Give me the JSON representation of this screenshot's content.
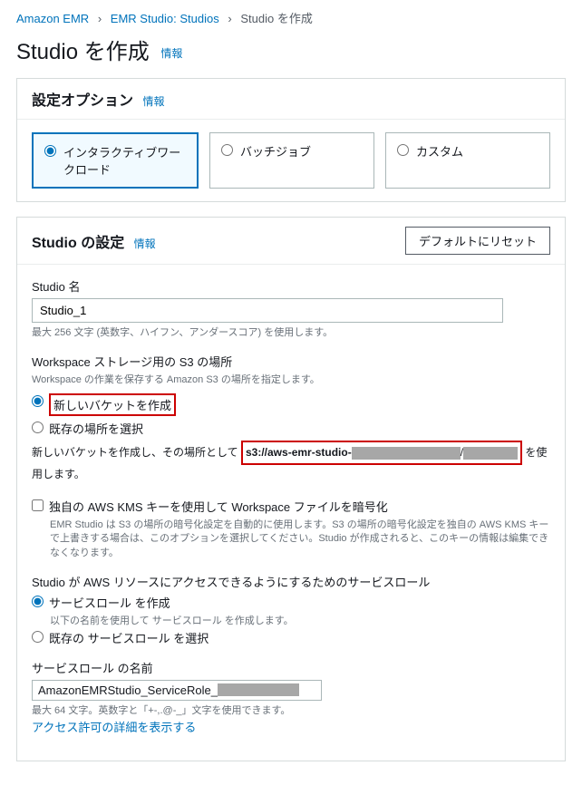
{
  "breadcrumb": {
    "items": [
      "Amazon EMR",
      "EMR Studio: Studios"
    ],
    "current": "Studio を作成"
  },
  "page": {
    "title": "Studio を作成",
    "info": "情報"
  },
  "setup_options": {
    "heading": "設定オプション",
    "info": "情報",
    "tiles": {
      "interactive": "インタラクティブワークロード",
      "batch": "バッチジョブ",
      "custom": "カスタム"
    },
    "selected": "interactive"
  },
  "studio_settings": {
    "heading": "Studio の設定",
    "info": "情報",
    "reset_button": "デフォルトにリセット",
    "name": {
      "label": "Studio 名",
      "value": "Studio_1",
      "hint": "最大 256 文字 (英数字、ハイフン、アンダースコア) を使用します。"
    },
    "s3": {
      "label": "Workspace ストレージ用の S3 の場所",
      "desc": "Workspace の作業を保存する Amazon S3 の場所を指定します。",
      "opt_create": "新しいバケットを作成",
      "opt_existing": "既存の場所を選択",
      "path_prefix_text": "新しいバケットを作成し、その場所として",
      "path_value": "s3://aws-emr-studio-",
      "path_suffix_text": "を使用します。"
    },
    "kms": {
      "label": "独自の AWS KMS キーを使用して Workspace ファイルを暗号化",
      "hint": "EMR Studio は S3 の場所の暗号化設定を自動的に使用します。S3 の場所の暗号化設定を独自の AWS KMS キーで上書きする場合は、このオプションを選択してください。Studio が作成されると、このキーの情報は編集できなくなります。"
    },
    "service_role": {
      "label": "Studio が AWS リソースにアクセスできるようにするためのサービスロール",
      "opt_create": "サービスロール を作成",
      "opt_create_hint": "以下の名前を使用して サービスロール を作成します。",
      "opt_existing": "既存の サービスロール を選択",
      "name_label": "サービスロール の名前",
      "name_value": "AmazonEMRStudio_ServiceRole_",
      "name_hint": "最大 64 文字。英数字と「+-,.@-_」文字を使用できます。",
      "permissions_link": "アクセス許可の詳細を表示する"
    }
  }
}
